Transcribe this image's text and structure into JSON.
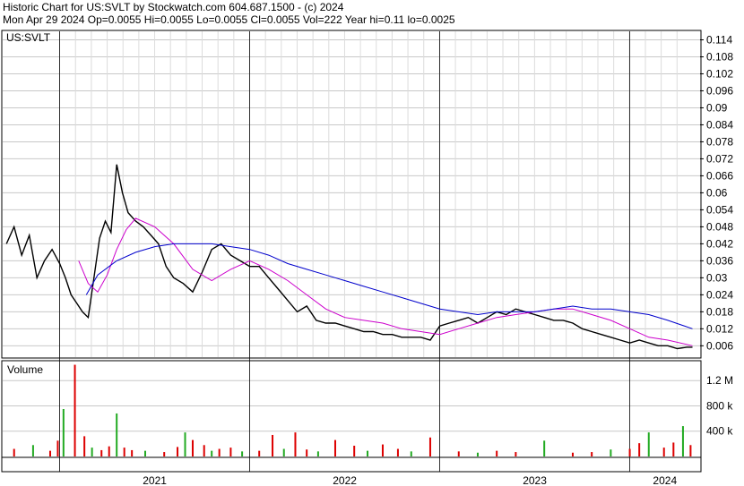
{
  "header": {
    "line1": "Historic Chart for US:SVLT by Stockwatch.com 604.687.1500 - (c) 2024",
    "line2": "Mon Apr 29 2024   Op=0.0055   Hi=0.0055   Lo=0.0055   Cl=0.0055   Vol=222   Year hi=0.11   lo=0.0025"
  },
  "chart_data": [
    {
      "type": "line",
      "title": "US:SVLT",
      "ylim": [
        0.002,
        0.117
      ],
      "yticks": [
        "0.114",
        "0.108",
        "0.102",
        "0.096",
        "0.09",
        "0.084",
        "0.078",
        "0.072",
        "0.066",
        "0.06",
        "0.054",
        "0.048",
        "0.042",
        "0.036",
        "0.03",
        "0.024",
        "0.018",
        "0.012",
        "0.006"
      ],
      "xlim": [
        2020.7,
        2024.37
      ],
      "series": [
        {
          "kind": "close",
          "color": "#000000",
          "x": [
            2020.72,
            2020.76,
            2020.8,
            2020.84,
            2020.88,
            2020.92,
            2020.96,
            2021.0,
            2021.03,
            2021.06,
            2021.09,
            2021.12,
            2021.15,
            2021.18,
            2021.21,
            2021.24,
            2021.27,
            2021.3,
            2021.33,
            2021.36,
            2021.4,
            2021.44,
            2021.48,
            2021.52,
            2021.56,
            2021.6,
            2021.65,
            2021.7,
            2021.75,
            2021.8,
            2021.85,
            2021.9,
            2021.95,
            2022.0,
            2022.05,
            2022.1,
            2022.15,
            2022.2,
            2022.25,
            2022.3,
            2022.35,
            2022.4,
            2022.45,
            2022.5,
            2022.55,
            2022.6,
            2022.65,
            2022.7,
            2022.75,
            2022.8,
            2022.85,
            2022.9,
            2022.95,
            2023.0,
            2023.05,
            2023.1,
            2023.15,
            2023.2,
            2023.25,
            2023.3,
            2023.35,
            2023.4,
            2023.45,
            2023.5,
            2023.55,
            2023.6,
            2023.65,
            2023.7,
            2023.75,
            2023.8,
            2023.85,
            2023.9,
            2023.95,
            2024.0,
            2024.05,
            2024.1,
            2024.15,
            2024.2,
            2024.25,
            2024.3,
            2024.33
          ],
          "values": [
            0.042,
            0.048,
            0.038,
            0.045,
            0.03,
            0.036,
            0.04,
            0.035,
            0.03,
            0.024,
            0.021,
            0.018,
            0.016,
            0.03,
            0.044,
            0.05,
            0.046,
            0.07,
            0.06,
            0.053,
            0.05,
            0.048,
            0.045,
            0.042,
            0.034,
            0.03,
            0.028,
            0.025,
            0.032,
            0.04,
            0.042,
            0.038,
            0.036,
            0.034,
            0.034,
            0.03,
            0.026,
            0.022,
            0.018,
            0.02,
            0.015,
            0.014,
            0.014,
            0.013,
            0.012,
            0.011,
            0.011,
            0.01,
            0.01,
            0.009,
            0.009,
            0.009,
            0.008,
            0.013,
            0.014,
            0.015,
            0.016,
            0.014,
            0.016,
            0.018,
            0.017,
            0.019,
            0.018,
            0.017,
            0.016,
            0.015,
            0.015,
            0.014,
            0.012,
            0.011,
            0.01,
            0.009,
            0.008,
            0.007,
            0.008,
            0.007,
            0.006,
            0.006,
            0.005,
            0.0055,
            0.0055
          ]
        },
        {
          "kind": "moving-average",
          "color": "#cc00cc",
          "x": [
            2021.1,
            2021.15,
            2021.2,
            2021.25,
            2021.3,
            2021.35,
            2021.4,
            2021.5,
            2021.6,
            2021.7,
            2021.8,
            2021.9,
            2022.0,
            2022.1,
            2022.2,
            2022.3,
            2022.4,
            2022.5,
            2022.6,
            2022.7,
            2022.8,
            2022.9,
            2023.0,
            2023.1,
            2023.2,
            2023.3,
            2023.4,
            2023.5,
            2023.6,
            2023.7,
            2023.8,
            2023.9,
            2024.0,
            2024.1,
            2024.2,
            2024.33
          ],
          "values": [
            0.036,
            0.028,
            0.025,
            0.031,
            0.04,
            0.047,
            0.051,
            0.048,
            0.042,
            0.033,
            0.029,
            0.033,
            0.036,
            0.033,
            0.029,
            0.024,
            0.019,
            0.016,
            0.015,
            0.014,
            0.012,
            0.011,
            0.01,
            0.012,
            0.014,
            0.016,
            0.017,
            0.018,
            0.019,
            0.019,
            0.017,
            0.015,
            0.012,
            0.009,
            0.008,
            0.006
          ]
        },
        {
          "kind": "moving-average",
          "color": "#0000cc",
          "x": [
            2021.14,
            2021.2,
            2021.3,
            2021.4,
            2021.5,
            2021.6,
            2021.7,
            2021.8,
            2021.9,
            2022.0,
            2022.1,
            2022.2,
            2022.3,
            2022.4,
            2022.5,
            2022.6,
            2022.7,
            2022.8,
            2022.9,
            2023.0,
            2023.1,
            2023.2,
            2023.3,
            2023.4,
            2023.5,
            2023.6,
            2023.7,
            2023.8,
            2023.9,
            2024.0,
            2024.1,
            2024.2,
            2024.33
          ],
          "values": [
            0.024,
            0.031,
            0.036,
            0.039,
            0.041,
            0.042,
            0.042,
            0.042,
            0.041,
            0.04,
            0.038,
            0.035,
            0.033,
            0.031,
            0.029,
            0.027,
            0.025,
            0.023,
            0.021,
            0.019,
            0.018,
            0.017,
            0.018,
            0.018,
            0.018,
            0.019,
            0.02,
            0.019,
            0.019,
            0.018,
            0.017,
            0.015,
            0.012
          ]
        }
      ]
    },
    {
      "type": "bar",
      "title": "Volume",
      "ylim": [
        0,
        1500000
      ],
      "yticks": [
        "1.2 M",
        "800 k",
        "400 k"
      ],
      "ytick_values": [
        1200000,
        800000,
        400000
      ],
      "x": [
        2020.76,
        2020.86,
        2020.95,
        2020.99,
        2021.02,
        2021.08,
        2021.13,
        2021.17,
        2021.22,
        2021.26,
        2021.3,
        2021.34,
        2021.38,
        2021.45,
        2021.55,
        2021.62,
        2021.66,
        2021.7,
        2021.76,
        2021.8,
        2021.84,
        2021.9,
        2021.96,
        2022.05,
        2022.12,
        2022.18,
        2022.24,
        2022.3,
        2022.36,
        2022.45,
        2022.55,
        2022.62,
        2022.7,
        2022.78,
        2022.85,
        2022.95,
        2023.1,
        2023.2,
        2023.3,
        2023.4,
        2023.55,
        2023.7,
        2023.8,
        2023.9,
        2024.0,
        2024.05,
        2024.1,
        2024.18,
        2024.23,
        2024.28,
        2024.32
      ],
      "values": [
        120000,
        180000,
        90000,
        250000,
        750000,
        1450000,
        320000,
        140000,
        100000,
        160000,
        680000,
        140000,
        100000,
        90000,
        70000,
        150000,
        380000,
        260000,
        180000,
        90000,
        120000,
        140000,
        80000,
        90000,
        340000,
        120000,
        380000,
        110000,
        80000,
        260000,
        170000,
        90000,
        190000,
        120000,
        80000,
        300000,
        80000,
        60000,
        90000,
        70000,
        250000,
        60000,
        70000,
        110000,
        120000,
        210000,
        380000,
        140000,
        220000,
        480000,
        180000
      ]
    }
  ],
  "xaxis": {
    "years": [
      "2021",
      "2022",
      "2023",
      "2024"
    ]
  }
}
